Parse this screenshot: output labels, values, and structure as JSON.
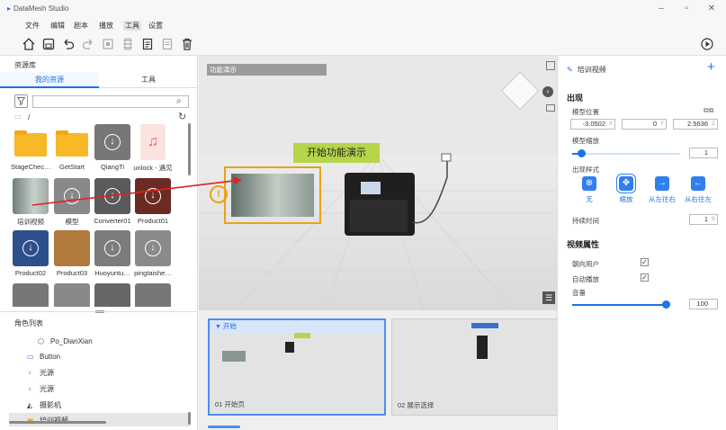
{
  "app": {
    "title": "DataMesh Studio"
  },
  "menu": [
    "文件",
    "编辑",
    "剧本",
    "播放",
    "工具",
    "设置"
  ],
  "left_panel": {
    "title": "资源库",
    "tabs": [
      {
        "label": "我的资源",
        "active": true
      },
      {
        "label": "工具",
        "active": false
      }
    ],
    "path": "/",
    "assets": [
      {
        "label": "StageChec…",
        "kind": "folder"
      },
      {
        "label": "GetStart",
        "kind": "folder"
      },
      {
        "label": "QiangTi",
        "kind": "download"
      },
      {
        "label": "unlock - 遇见",
        "kind": "audio"
      },
      {
        "label": "培训视频",
        "kind": "video"
      },
      {
        "label": "模型",
        "kind": "download"
      },
      {
        "label": "Converter01",
        "kind": "download"
      },
      {
        "label": "Product01",
        "kind": "download"
      },
      {
        "label": "Product02",
        "kind": "download"
      },
      {
        "label": "Product03",
        "kind": "box"
      },
      {
        "label": "Huoyuntu…",
        "kind": "download"
      },
      {
        "label": "pingtaishe…",
        "kind": "download"
      }
    ],
    "roles_title": "角色列表",
    "roles": [
      {
        "label": "Po_DianXian",
        "icon": "cube-icon"
      },
      {
        "label": "Button",
        "icon": "button-icon"
      },
      {
        "label": "光源",
        "icon": "bulb-icon"
      },
      {
        "label": "光源",
        "icon": "bulb-icon"
      },
      {
        "label": "摄影机",
        "icon": "camera-icon"
      },
      {
        "label": "培训视频",
        "icon": "video-icon"
      }
    ]
  },
  "viewport": {
    "scene_title": "功能演示",
    "callout": "开始功能演示"
  },
  "timeline": {
    "scenes": [
      {
        "header": "开始",
        "name": "01 开始页",
        "selected": true
      },
      {
        "header": "",
        "name": "02 展示选择",
        "selected": false
      }
    ]
  },
  "right_panel": {
    "header": "培训视频",
    "section_appear": "出现",
    "position_label": "模型位置",
    "position": {
      "x": "-3.0502",
      "y": "0",
      "z": "2.5636"
    },
    "scale_label": "模型缩放",
    "scale_value": "1",
    "scale_level": 0.08,
    "style_label": "出现样式",
    "styles": [
      {
        "label": "无",
        "icon": "⊗"
      },
      {
        "label": "缩放",
        "icon": "✥",
        "selected": true
      },
      {
        "label": "从左往右",
        "icon": "→"
      },
      {
        "label": "从右往左",
        "icon": "←"
      }
    ],
    "duration_label": "持续时间",
    "duration_value": "1",
    "duration_unit": "S",
    "section_video": "视频属性",
    "face_user_label": "朝向用户",
    "face_user": true,
    "autoplay_label": "自动播放",
    "autoplay": true,
    "volume_label": "音量",
    "volume_value": "100",
    "volume_level": 1.0
  }
}
